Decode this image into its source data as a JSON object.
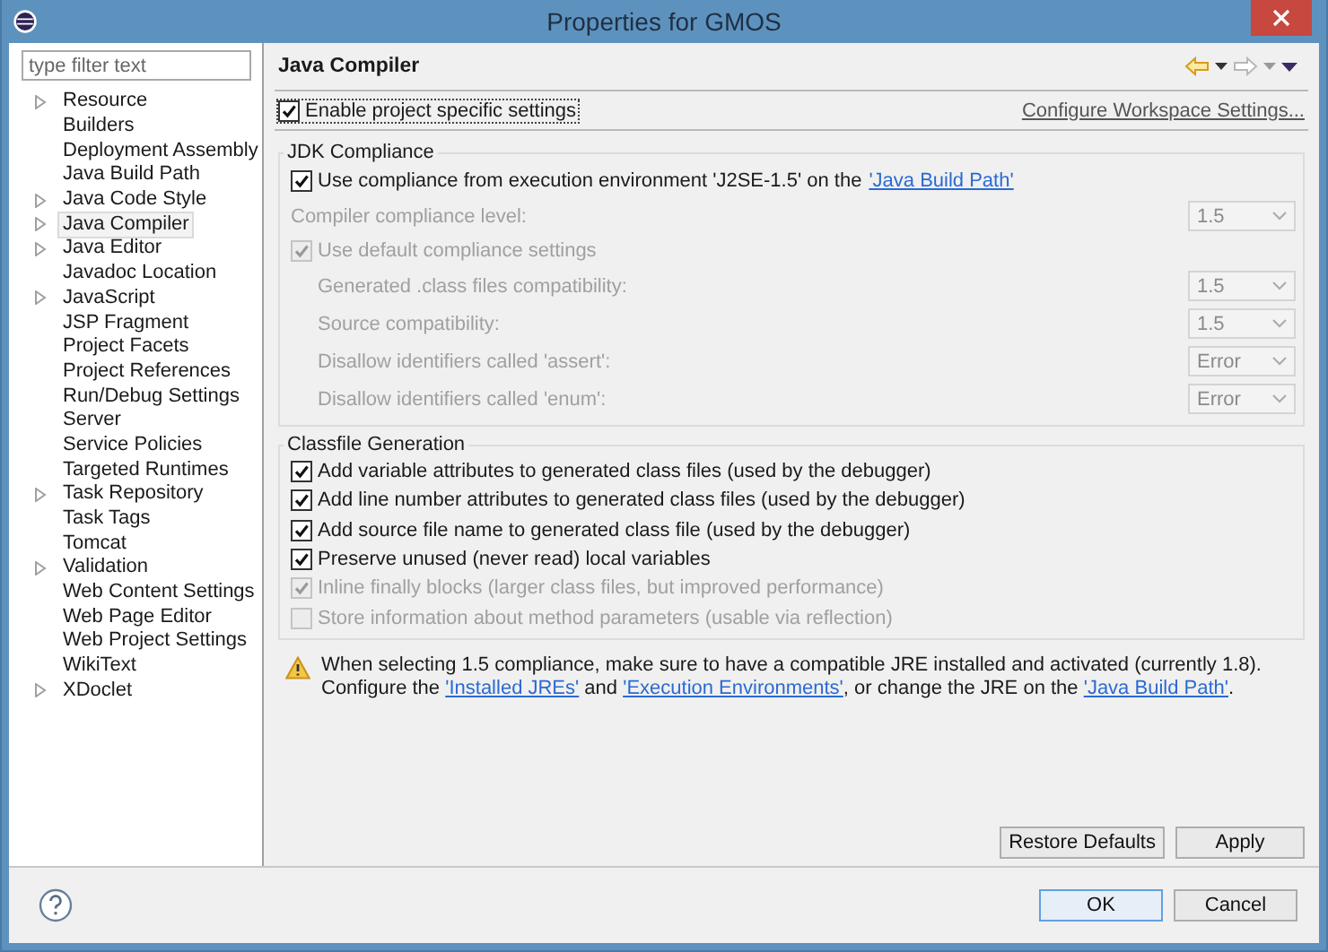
{
  "window": {
    "title": "Properties for GMOS"
  },
  "filter": {
    "placeholder": "type filter text"
  },
  "sidebar": {
    "items": [
      {
        "label": "Resource",
        "kind": "folder",
        "selected": false
      },
      {
        "label": "Builders",
        "kind": "leaf",
        "selected": false
      },
      {
        "label": "Deployment Assembly",
        "kind": "leaf",
        "selected": false
      },
      {
        "label": "Java Build Path",
        "kind": "leaf",
        "selected": false
      },
      {
        "label": "Java Code Style",
        "kind": "folder",
        "selected": false
      },
      {
        "label": "Java Compiler",
        "kind": "folder",
        "selected": true
      },
      {
        "label": "Java Editor",
        "kind": "folder",
        "selected": false
      },
      {
        "label": "Javadoc Location",
        "kind": "leaf",
        "selected": false
      },
      {
        "label": "JavaScript",
        "kind": "folder",
        "selected": false
      },
      {
        "label": "JSP Fragment",
        "kind": "leaf",
        "selected": false
      },
      {
        "label": "Project Facets",
        "kind": "leaf",
        "selected": false
      },
      {
        "label": "Project References",
        "kind": "leaf",
        "selected": false
      },
      {
        "label": "Run/Debug Settings",
        "kind": "leaf",
        "selected": false
      },
      {
        "label": "Server",
        "kind": "leaf",
        "selected": false
      },
      {
        "label": "Service Policies",
        "kind": "leaf",
        "selected": false
      },
      {
        "label": "Targeted Runtimes",
        "kind": "leaf",
        "selected": false
      },
      {
        "label": "Task Repository",
        "kind": "folder",
        "selected": false
      },
      {
        "label": "Task Tags",
        "kind": "leaf",
        "selected": false
      },
      {
        "label": "Tomcat",
        "kind": "leaf",
        "selected": false
      },
      {
        "label": "Validation",
        "kind": "folder",
        "selected": false
      },
      {
        "label": "Web Content Settings",
        "kind": "leaf",
        "selected": false
      },
      {
        "label": "Web Page Editor",
        "kind": "leaf",
        "selected": false
      },
      {
        "label": "Web Project Settings",
        "kind": "leaf",
        "selected": false
      },
      {
        "label": "WikiText",
        "kind": "leaf",
        "selected": false
      },
      {
        "label": "XDoclet",
        "kind": "folder",
        "selected": false
      }
    ]
  },
  "page": {
    "title": "Java Compiler",
    "enable": {
      "label": "Enable project specific settings",
      "checked": true
    },
    "workspace_link": "Configure Workspace Settings...",
    "jdk": {
      "title": "JDK Compliance",
      "use_env": {
        "label": "Use compliance from execution environment 'J2SE-1.5' on the",
        "link": "'Java Build Path'",
        "checked": true
      },
      "level": {
        "label": "Compiler compliance level:",
        "value": "1.5",
        "disabled": true
      },
      "use_default": {
        "label": "Use default compliance settings",
        "checked": true,
        "disabled": true
      },
      "settings": [
        {
          "label": "Generated .class files compatibility:",
          "value": "1.5",
          "disabled": true
        },
        {
          "label": "Source compatibility:",
          "value": "1.5",
          "disabled": true
        },
        {
          "label": "Disallow identifiers called 'assert':",
          "value": "Error",
          "disabled": true
        },
        {
          "label": "Disallow identifiers called 'enum':",
          "value": "Error",
          "disabled": true
        }
      ]
    },
    "classfile": {
      "title": "Classfile Generation",
      "options": [
        {
          "label": "Add variable attributes to generated class files (used by the debugger)",
          "checked": true,
          "disabled": false
        },
        {
          "label": "Add line number attributes to generated class files (used by the debugger)",
          "checked": true,
          "disabled": false
        },
        {
          "label": "Add source file name to generated class file (used by the debugger)",
          "checked": true,
          "disabled": false
        },
        {
          "label": "Preserve unused (never read) local variables",
          "checked": true,
          "disabled": false
        },
        {
          "label": "Inline finally blocks (larger class files, but improved performance)",
          "checked": true,
          "disabled": true
        },
        {
          "label": "Store information about method parameters (usable via reflection)",
          "checked": false,
          "disabled": true
        }
      ]
    },
    "warning": [
      {
        "kind": "text",
        "text": "When selecting 1.5 compliance, make sure to have a compatible JRE installed and activated (currently 1.8). Configure the "
      },
      {
        "kind": "link",
        "text": "'Installed JREs'"
      },
      {
        "kind": "text",
        "text": " and "
      },
      {
        "kind": "link",
        "text": "'Execution Environments'"
      },
      {
        "kind": "text",
        "text": ", or change the JRE on the "
      },
      {
        "kind": "link",
        "text": "'Java Build Path'"
      },
      {
        "kind": "text",
        "text": "."
      }
    ],
    "buttons": [
      "Restore Defaults",
      "Apply"
    ]
  },
  "footer": {
    "buttons": [
      {
        "label": "OK",
        "default": true
      },
      {
        "label": "Cancel",
        "default": false
      }
    ]
  }
}
